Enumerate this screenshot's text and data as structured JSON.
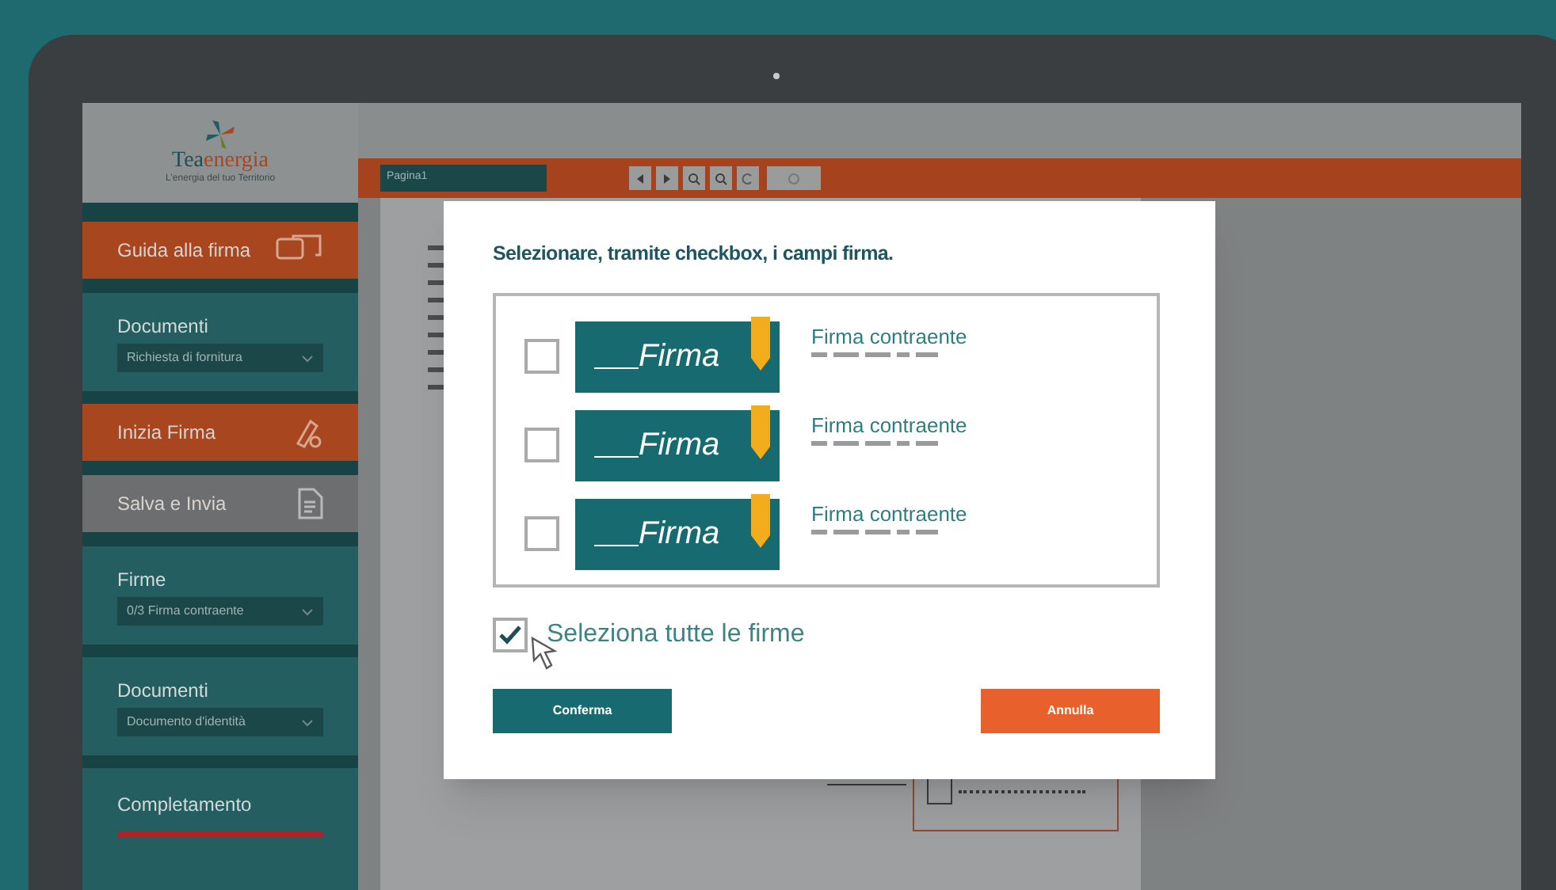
{
  "logo": {
    "name_part_1": "Tea",
    "name_part_2": "energia",
    "tagline": "L'energia del tuo Territorio"
  },
  "sidebar": {
    "items": [
      {
        "kind": "action",
        "label": "Guida alla firma",
        "color": "#a8461f"
      },
      {
        "kind": "select",
        "label": "Documenti",
        "value": "Richiesta di fornitura"
      },
      {
        "kind": "action",
        "label": "Inizia Firma",
        "color": "#a8461f"
      },
      {
        "kind": "action",
        "label": "Salva e Invia",
        "color": "#6c6e6f"
      },
      {
        "kind": "select",
        "label": "Firme",
        "value": "0/3 Firma contraente"
      },
      {
        "kind": "select",
        "label": "Documenti",
        "value": "Documento d'identità"
      },
      {
        "kind": "progress",
        "label": "Completamento",
        "level": 1
      }
    ]
  },
  "toolbar": {
    "page_select": "Pagina1"
  },
  "dialog": {
    "title": "Selezionare, tramite checkbox, i campi firma.",
    "signatures": [
      {
        "checked": false,
        "stamp": "Firma",
        "label": "Firma contraente"
      },
      {
        "checked": false,
        "stamp": "Firma",
        "label": "Firma contraente"
      },
      {
        "checked": false,
        "stamp": "Firma",
        "label": "Firma contraente"
      }
    ],
    "select_all": {
      "label": "Seleziona tutte le firme",
      "checked": true
    },
    "buttons": [
      {
        "kind": "confirm",
        "label": "Conferma"
      },
      {
        "kind": "cancel",
        "label": "Annulla"
      }
    ]
  }
}
